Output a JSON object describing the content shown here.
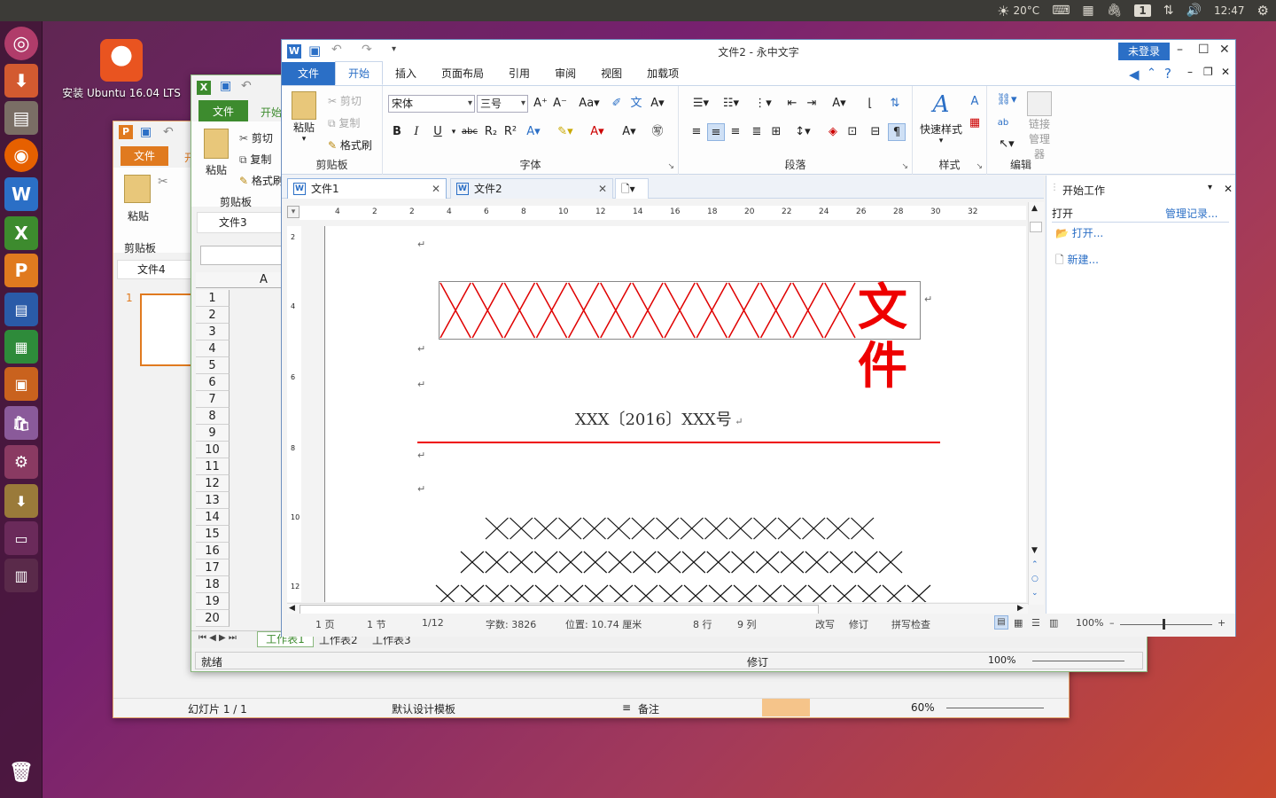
{
  "topbar": {
    "weather": "20°C",
    "workspace": "1",
    "clock": "12:47"
  },
  "desktop": {
    "icon_label": "安装 Ubuntu 16.04 LTS"
  },
  "present": {
    "file_tab": "文件",
    "tab_start": "开",
    "paste": "粘贴",
    "clipboard": "剪贴板",
    "doc_tab": "文件4",
    "slide_num": "1",
    "status_slide": "幻灯片 1 / 1",
    "status_template": "默认设计模板",
    "status_notes": "备注",
    "zoom": "60%"
  },
  "sheet": {
    "file_tab": "文件",
    "tab_start": "开始",
    "paste": "粘贴",
    "cut": "剪切",
    "copy": "复制",
    "format": "格式刷",
    "clipboard": "剪贴板",
    "doc_tab": "文件3",
    "col_a": "A",
    "rows": [
      "1",
      "2",
      "3",
      "4",
      "5",
      "6",
      "7",
      "8",
      "9",
      "10",
      "11",
      "12",
      "13",
      "14",
      "15",
      "16",
      "17",
      "18",
      "19",
      "20"
    ],
    "sheets": [
      "工作表1",
      "工作表2",
      "工作表3"
    ],
    "status_ready": "就绪",
    "status_rev": "修订",
    "zoom": "100%"
  },
  "writer": {
    "title": "文件2 - 永中文字",
    "login": "未登录",
    "menus": {
      "file": "文件",
      "start": "开始",
      "insert": "插入",
      "layout": "页面布局",
      "ref": "引用",
      "review": "审阅",
      "view": "视图",
      "addins": "加载项"
    },
    "ribbon": {
      "paste": "粘贴",
      "cut": "剪切",
      "copy": "复制",
      "format_painter": "格式刷",
      "clipboard": "剪贴板",
      "font_name": "宋体",
      "font_size": "三号",
      "font": "字体",
      "paragraph": "段落",
      "quick_styles": "快速样式",
      "styles": "样式",
      "edit": "编辑",
      "link_manager_1": "链接",
      "link_manager_2": "管理器",
      "bold": "B",
      "italic": "I",
      "underline": "U",
      "strike": "abc"
    },
    "tabs": {
      "doc1": "文件1",
      "doc2": "文件2"
    },
    "doc": {
      "header_text": "文件",
      "ref_line": "XXX〔2016〕XXX号"
    },
    "status": {
      "page": "1 页",
      "section": "1 节",
      "pages": "1/12",
      "words": "字数: 3826",
      "position": "位置: 10.74 厘米",
      "line": "8 行",
      "col": "9 列",
      "overwrite": "改写",
      "revise": "修订",
      "spell": "拼写检查",
      "zoom": "100%"
    },
    "taskpane": {
      "title": "开始工作",
      "open_label": "打开",
      "history": "管理记录...",
      "open_link": "打开...",
      "new_link": "新建..."
    },
    "ruler_ticks": [
      "4",
      "2",
      "2",
      "4",
      "6",
      "8",
      "10",
      "12",
      "14",
      "16",
      "18",
      "20",
      "22",
      "24",
      "26",
      "28",
      "30",
      "32"
    ]
  },
  "colors": {
    "accent": "#2b6fc6",
    "sheet_green": "#3d8b2e",
    "present_orange": "#e07a1f",
    "doc_red": "#e00000"
  }
}
